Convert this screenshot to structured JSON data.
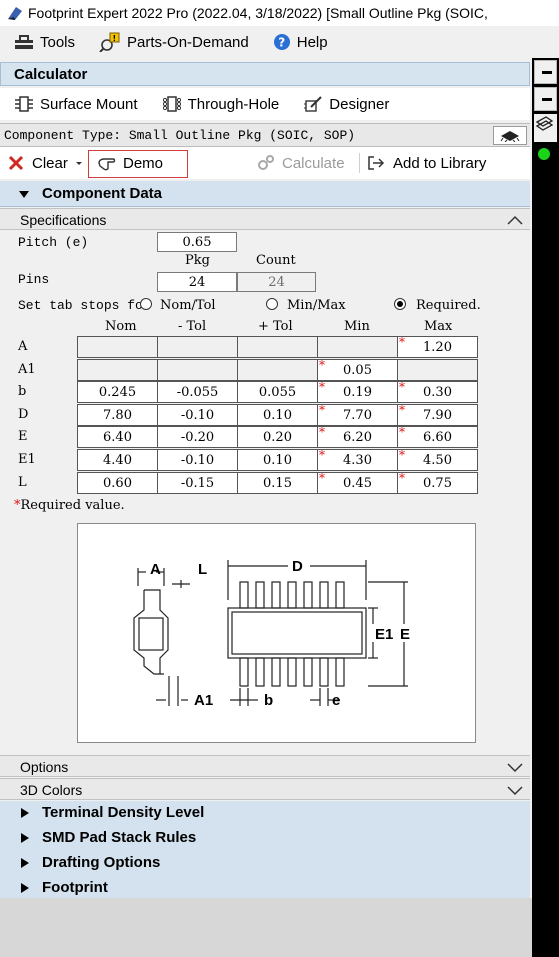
{
  "window": {
    "title": "Footprint Expert 2022 Pro (2022.04, 3/18/2022) [Small Outline Pkg (SOIC,"
  },
  "menu": [
    {
      "label": "Tools",
      "icon": "toolbox-icon"
    },
    {
      "label": "Parts-On-Demand",
      "icon": "parts-on-demand-icon"
    },
    {
      "label": "Help",
      "icon": "help-icon"
    }
  ],
  "calculator": {
    "header": "Calculator",
    "tabs": [
      {
        "label": "Surface Mount",
        "icon": "surface-mount-icon"
      },
      {
        "label": "Through-Hole",
        "icon": "through-hole-icon"
      },
      {
        "label": "Designer",
        "icon": "designer-icon"
      }
    ],
    "component_type": "Component Type: Small Outline Pkg (SOIC, SOP)",
    "actions": {
      "clear": "Clear",
      "demo": "Demo",
      "calculate": "Calculate",
      "add_to_library": "Add to Library"
    },
    "component_data_header": "Component Data",
    "specifications_header": "Specifications"
  },
  "specs": {
    "pitch_label": "Pitch (e)",
    "pitch_value": "0.65",
    "pkg_header": "Pkg",
    "count_header": "Count",
    "pins_label": "Pins",
    "pins_pkg": "24",
    "pins_count": "24",
    "tabstops_label": "Set tab stops fo",
    "radio_nomtol": "Nom/Tol",
    "radio_minmax": "Min/Max",
    "radio_required": "Required.",
    "selected_radio": "Required.",
    "col_headers": [
      "Nom",
      "- Tol",
      "+ Tol",
      "Min",
      "Max"
    ],
    "rows": [
      {
        "name": "A",
        "nom": "",
        "tol_minus": "",
        "tol_plus": "",
        "min": "",
        "max": "1.20",
        "min_req": false,
        "max_req": true
      },
      {
        "name": "A1",
        "nom": "",
        "tol_minus": "",
        "tol_plus": "",
        "min": "0.05",
        "max": "",
        "min_req": true,
        "max_req": false
      },
      {
        "name": "b",
        "nom": "0.245",
        "tol_minus": "-0.055",
        "tol_plus": "0.055",
        "min": "0.19",
        "max": "0.30",
        "min_req": true,
        "max_req": true
      },
      {
        "name": "D",
        "nom": "7.80",
        "tol_minus": "-0.10",
        "tol_plus": "0.10",
        "min": "7.70",
        "max": "7.90",
        "min_req": true,
        "max_req": true
      },
      {
        "name": "E",
        "nom": "6.40",
        "tol_minus": "-0.20",
        "tol_plus": "0.20",
        "min": "6.20",
        "max": "6.60",
        "min_req": true,
        "max_req": true
      },
      {
        "name": "E1",
        "nom": "4.40",
        "tol_minus": "-0.10",
        "tol_plus": "0.10",
        "min": "4.30",
        "max": "4.50",
        "min_req": true,
        "max_req": true
      },
      {
        "name": "L",
        "nom": "0.60",
        "tol_minus": "-0.15",
        "tol_plus": "0.15",
        "min": "0.45",
        "max": "0.75",
        "min_req": true,
        "max_req": true
      }
    ],
    "required_note": "Required value.",
    "required_mark": "*",
    "diagram_labels": {
      "A": "A",
      "L": "L",
      "D": "D",
      "E1": "E1",
      "E": "E",
      "A1": "A1",
      "b": "b",
      "e": "e"
    }
  },
  "sections": {
    "options": "Options",
    "colors_3d": "3D Colors",
    "items": [
      "Terminal Density Level",
      "SMD Pad Stack Rules",
      "Drafting Options",
      "Footprint"
    ]
  },
  "colors": {
    "accent_header": "#d4e2ef",
    "required_red": "#e01616",
    "status_green": "#19d419"
  }
}
